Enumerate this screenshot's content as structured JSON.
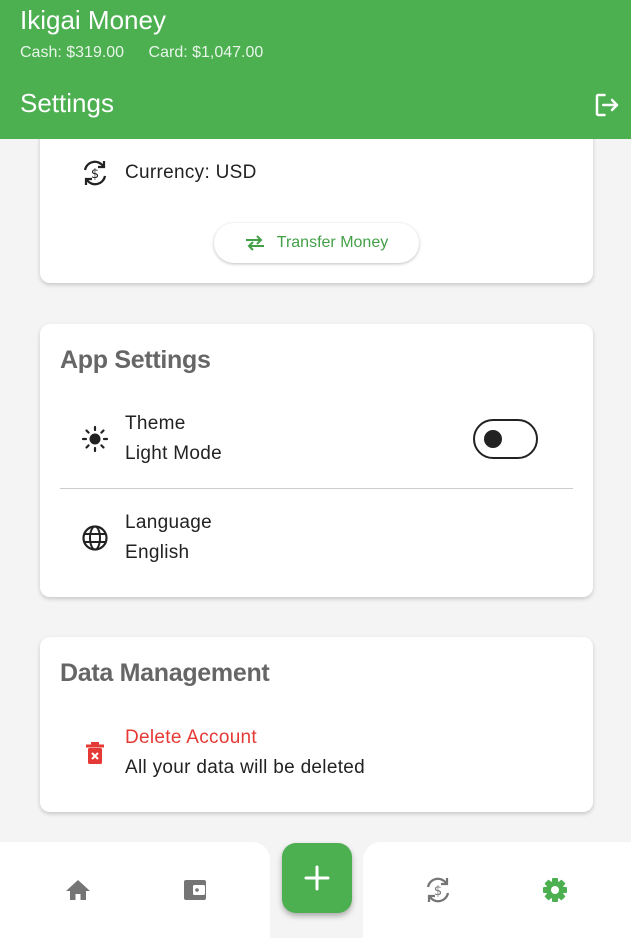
{
  "app": {
    "title": "Ikigai Money"
  },
  "balances": {
    "cash": "Cash: $319.00",
    "card": "Card: $1,047.00"
  },
  "page": {
    "title": "Settings"
  },
  "account_card": {
    "currency": "Currency: USD",
    "transfer_label": "Transfer Money"
  },
  "app_settings": {
    "title": "App Settings",
    "theme": {
      "label": "Theme",
      "value": "Light Mode",
      "toggle_on": false
    },
    "language": {
      "label": "Language",
      "value": "English"
    }
  },
  "data_management": {
    "title": "Data Management",
    "delete": {
      "label": "Delete Account",
      "subtitle": "All your data will be deleted"
    }
  },
  "nav": {
    "items": [
      "home-icon",
      "wallet-icon",
      "currency-exchange-icon",
      "gear-icon"
    ],
    "active": "gear-icon"
  },
  "colors": {
    "primary": "#4caf50",
    "accent_text": "#43a047",
    "danger": "#e53935",
    "nav_inactive": "#757575"
  }
}
